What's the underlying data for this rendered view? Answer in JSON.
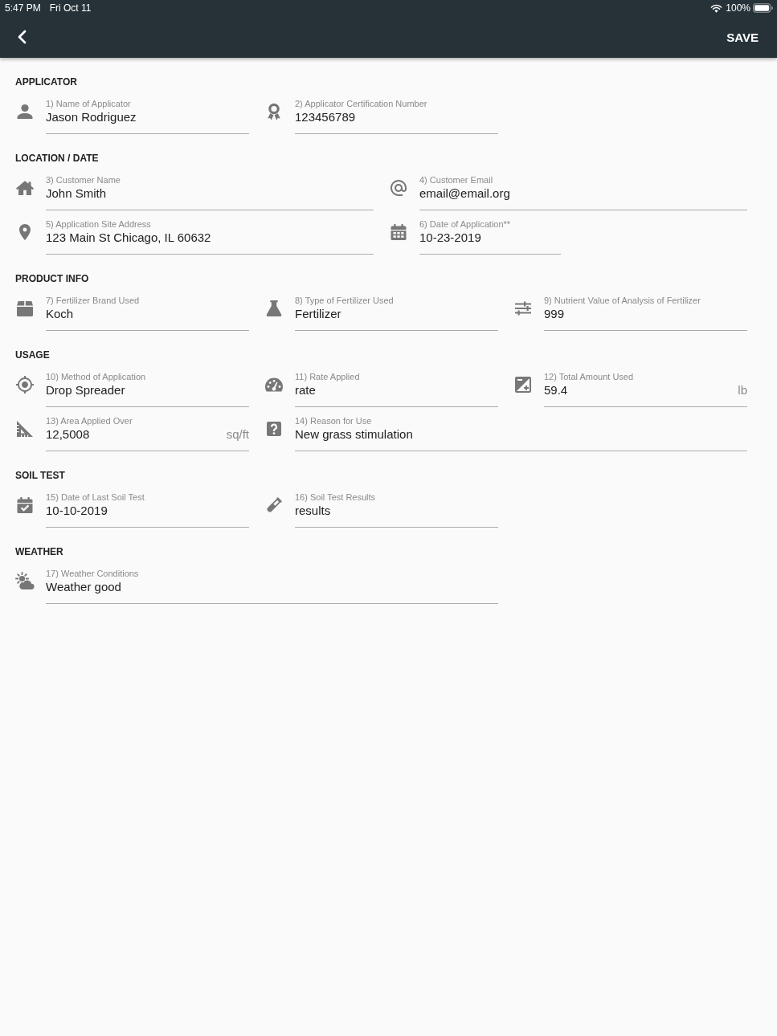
{
  "status_bar": {
    "time": "5:47 PM",
    "date": "Fri Oct 11",
    "battery": "100%"
  },
  "app_bar": {
    "save_button": "SAVE"
  },
  "sections": [
    {
      "title": "APPLICATOR",
      "fields": [
        {
          "label": "1) Name of Applicator",
          "value": "Jason Rodriguez"
        },
        {
          "label": "2) Applicator Certification Number",
          "value": "123456789"
        }
      ]
    },
    {
      "title": "LOCATION / DATE",
      "fields": [
        {
          "label": "3) Customer Name",
          "value": "John Smith"
        },
        {
          "label": "4) Customer Email",
          "value": "email@email.org"
        },
        {
          "label": "5) Application Site Address",
          "value": "123 Main St Chicago, IL 60632"
        },
        {
          "label": "6) Date of Application**",
          "value": "10-23-2019"
        }
      ]
    },
    {
      "title": "PRODUCT INFO",
      "fields": [
        {
          "label": "7) Fertilizer Brand Used",
          "value": "Koch"
        },
        {
          "label": "8) Type of Fertilizer Used",
          "value": "Fertilizer"
        },
        {
          "label": "9) Nutrient Value of Analysis of Fertilizer",
          "value": "999"
        }
      ]
    },
    {
      "title": "USAGE",
      "fields": [
        {
          "label": "10) Method of Application",
          "value": "Drop Spreader"
        },
        {
          "label": "11) Rate Applied",
          "value": "rate"
        },
        {
          "label": "12) Total Amount Used",
          "value": "59.4",
          "unit": "lb"
        },
        {
          "label": "13) Area Applied Over",
          "value": "12,5008",
          "unit": "sq/ft"
        },
        {
          "label": "14) Reason for Use",
          "value": "New grass stimulation"
        }
      ]
    },
    {
      "title": "SOIL TEST",
      "fields": [
        {
          "label": "15) Date of Last Soil Test",
          "value": "10-10-2019"
        },
        {
          "label": "16) Soil Test Results",
          "value": "results"
        }
      ]
    },
    {
      "title": "WEATHER",
      "fields": [
        {
          "label": "17) Weather Conditions",
          "value": "Weather good"
        }
      ]
    }
  ]
}
